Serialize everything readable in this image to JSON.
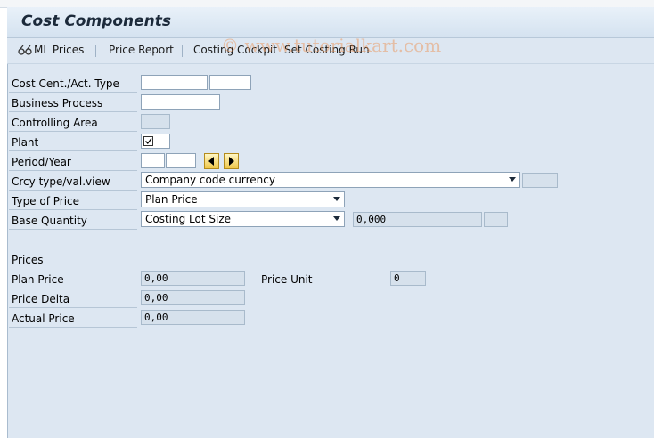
{
  "window": {
    "title": "Cost Components"
  },
  "toolbar": {
    "ml_prices": "ML Prices",
    "price_report": "Price Report",
    "costing_cockpit": "Costing Cockpit",
    "set_costing_run": "Set Costing Run"
  },
  "watermark": "© www.tutorialkart.com",
  "form": {
    "cost_center_label": "Cost Cent./Act. Type",
    "cost_center_value": "",
    "activity_type_value": "",
    "business_process_label": "Business Process",
    "business_process_value": "",
    "controlling_area_label": "Controlling Area",
    "controlling_area_value": "",
    "plant_label": "Plant",
    "plant_checked": true,
    "period_year_label": "Period/Year",
    "period_value": "",
    "year_value": "",
    "crcy_label": "Crcy type/val.view",
    "crcy_value": "Company code currency",
    "type_of_price_label": "Type of Price",
    "type_of_price_value": "Plan Price",
    "base_quantity_label": "Base Quantity",
    "base_quantity_value": "Costing Lot Size",
    "base_quantity_amount": "0,000"
  },
  "prices": {
    "section_label": "Prices",
    "plan_price_label": "Plan Price",
    "plan_price_value": "0,00",
    "price_unit_label": "Price Unit",
    "price_unit_value": "0",
    "price_delta_label": "Price Delta",
    "price_delta_value": "0,00",
    "actual_price_label": "Actual Price",
    "actual_price_value": "0,00"
  }
}
